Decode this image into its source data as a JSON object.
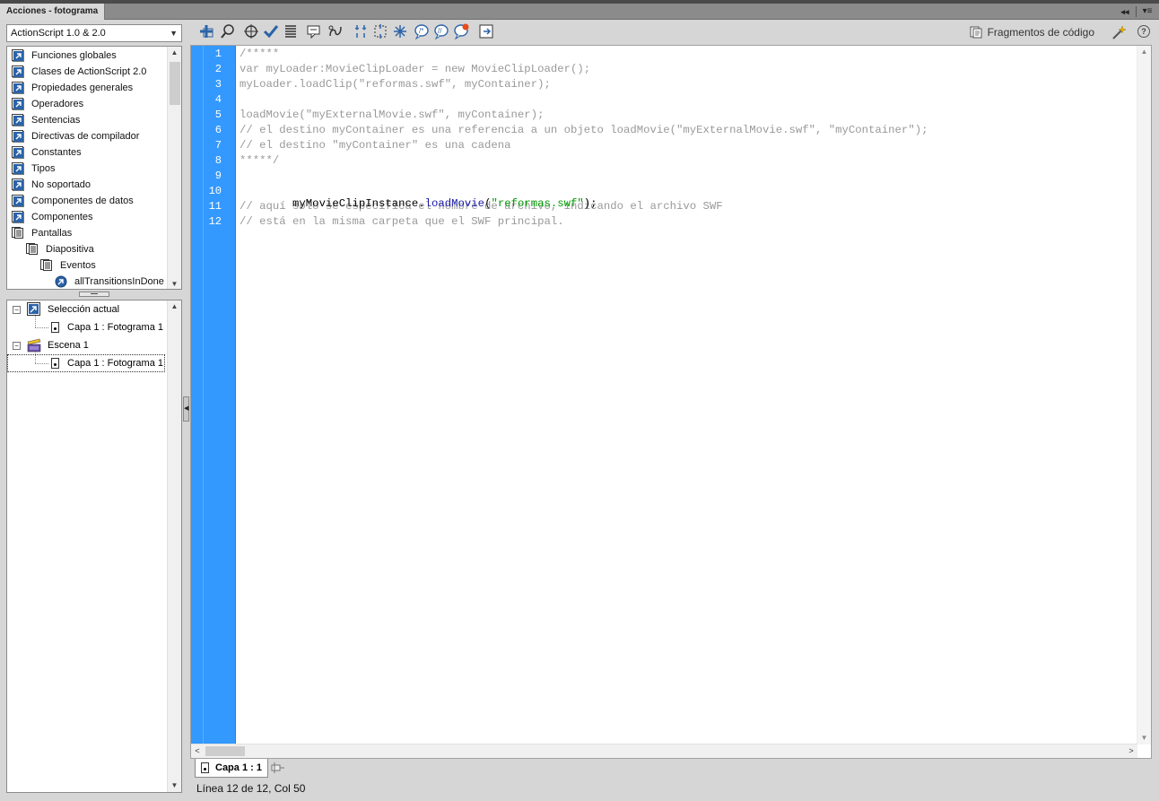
{
  "window": {
    "tab_title": "Acciones - fotograma",
    "collapse_glyph": "◂◂",
    "menu_glyph": "▾≡"
  },
  "language_select": {
    "value": "ActionScript 1.0 & 2.0"
  },
  "toolbox": {
    "items": [
      {
        "label": "Funciones globales",
        "icon": "book-icon"
      },
      {
        "label": "Clases de ActionScript 2.0",
        "icon": "book-icon"
      },
      {
        "label": "Propiedades generales",
        "icon": "book-icon"
      },
      {
        "label": "Operadores",
        "icon": "book-icon"
      },
      {
        "label": "Sentencias",
        "icon": "book-icon"
      },
      {
        "label": "Directivas de compilador",
        "icon": "book-icon"
      },
      {
        "label": "Constantes",
        "icon": "book-icon"
      },
      {
        "label": "Tipos",
        "icon": "book-icon"
      },
      {
        "label": "No soportado",
        "icon": "book-icon"
      },
      {
        "label": "Componentes de datos",
        "icon": "book-icon"
      },
      {
        "label": "Componentes",
        "icon": "book-icon"
      },
      {
        "label": "Pantallas",
        "icon": "open-book-icon"
      },
      {
        "label": "Diapositiva",
        "icon": "open-book-icon"
      },
      {
        "label": "Eventos",
        "icon": "open-book-icon"
      },
      {
        "label": "allTransitionsInDone",
        "icon": "event-icon"
      }
    ]
  },
  "script_navigator": {
    "items": [
      {
        "label": "Selección actual",
        "icon": "selection-icon",
        "expander": "−"
      },
      {
        "label": "Capa 1 : Fotograma 1",
        "icon": "frame-script-icon"
      },
      {
        "label": "Escena 1",
        "icon": "scene-clapper-icon",
        "expander": "−"
      },
      {
        "label": "Capa 1 : Fotograma 1",
        "icon": "frame-script-icon"
      }
    ]
  },
  "toolbar": {
    "buttons": [
      "add-action-icon",
      "find-icon",
      "target-path-icon",
      "check-syntax-icon",
      "auto-format-icon",
      "code-hint-icon",
      "debug-options-icon",
      "collapse-between-braces-icon",
      "collapse-selection-icon",
      "expand-all-icon",
      "apply-block-comment-icon",
      "apply-line-comment-icon",
      "remove-comment-icon",
      "show-hide-toolbox-icon"
    ],
    "snippets_label": "Fragmentos de código",
    "help_glyph": "?"
  },
  "editor": {
    "line_numbers": [
      "1",
      "2",
      "3",
      "4",
      "5",
      "6",
      "7",
      "8",
      "9",
      "10",
      "11",
      "12"
    ],
    "lines": [
      "/*****",
      "var myLoader:MovieClipLoader = new MovieClipLoader();",
      "myLoader.loadClip(\"reformas.swf\", myContainer);",
      "",
      "loadMovie(\"myExternalMovie.swf\", myContainer);",
      "// el destino myContainer es una referencia a un objeto loadMovie(\"myExternalMovie.swf\", \"myContainer\");",
      "// el destino \"myContainer\" es una cadena",
      "*****/",
      "",
      "",
      "// aquí solo se especifica el nombre de archivo, indicando el archivo SWF",
      "// está en la misma carpeta que el SWF principal."
    ],
    "line10": {
      "ident": "myMovieClipInstance.",
      "fn": "loadMovie",
      "open": "(",
      "str": "\"reformas.swf\"",
      "close": ");"
    }
  },
  "script_tab": {
    "label": "Capa 1 : 1"
  },
  "status": {
    "text": "Línea 12 de 12, Col 50"
  },
  "colors": {
    "gutter": "#3399ff",
    "comment": "#999999",
    "function": "#1a1aa6",
    "string": "#009900"
  }
}
